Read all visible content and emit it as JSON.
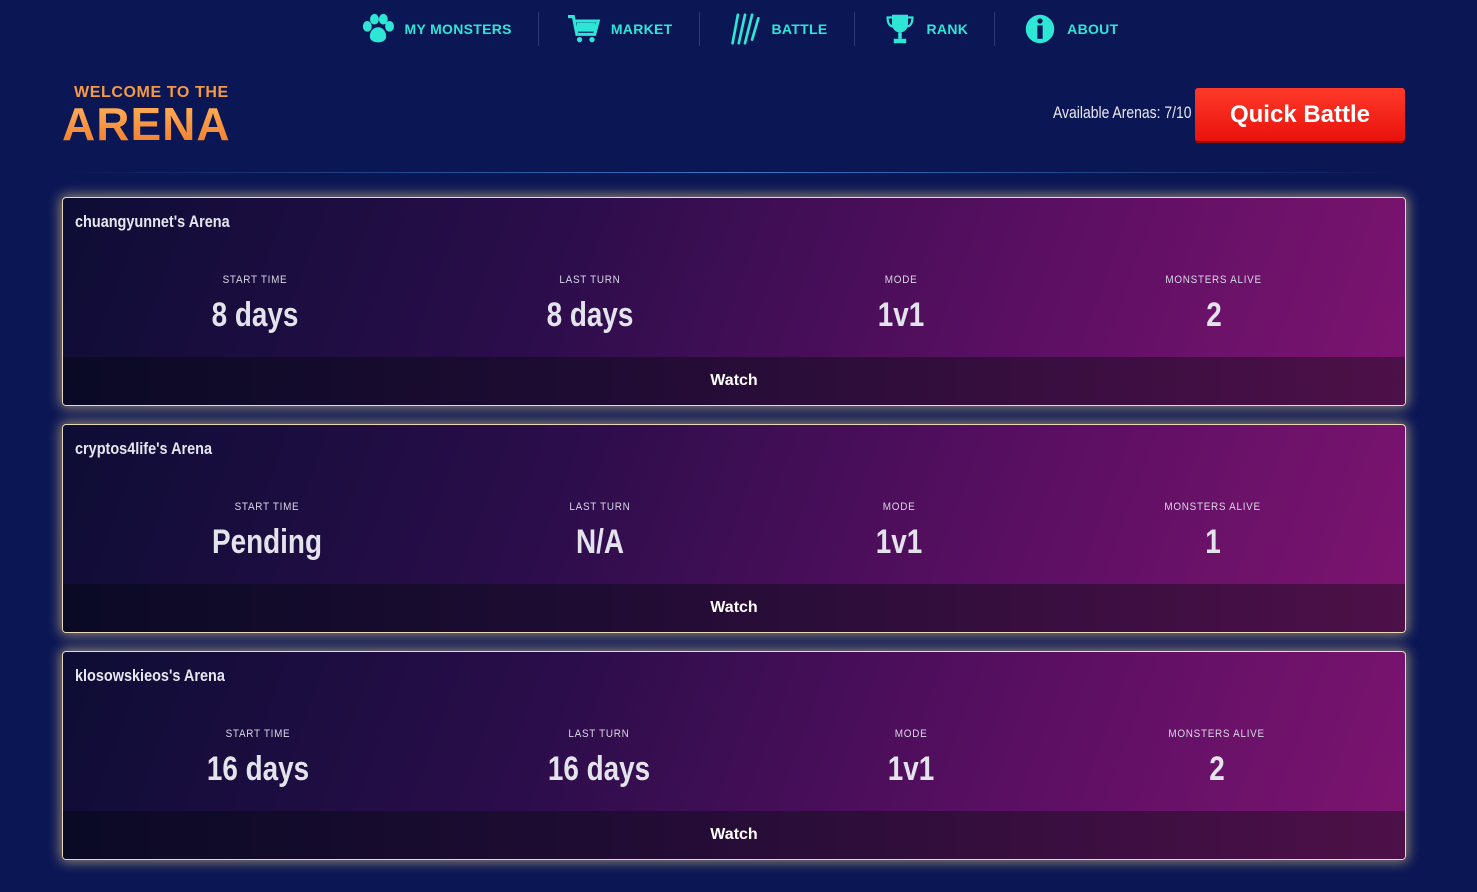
{
  "nav": {
    "items": [
      {
        "label": "MY MONSTERS",
        "icon": "paw-icon"
      },
      {
        "label": "MARKET",
        "icon": "cart-icon"
      },
      {
        "label": "BATTLE",
        "icon": "claw-icon"
      },
      {
        "label": "RANK",
        "icon": "trophy-icon"
      },
      {
        "label": "ABOUT",
        "icon": "info-icon"
      }
    ]
  },
  "header": {
    "welcome_small": "WELCOME TO THE",
    "welcome_big": "ARENA",
    "available_arenas": "Available Arenas: 7/10",
    "quick_battle_label": "Quick Battle"
  },
  "labels": {
    "start_time": "START TIME",
    "last_turn": "LAST TURN",
    "mode": "MODE",
    "monsters_alive": "MONSTERS ALIVE",
    "watch": "Watch"
  },
  "arenas": [
    {
      "title": "chuangyunnet's Arena",
      "start_time": "8 days",
      "last_turn": "8 days",
      "mode": "1v1",
      "monsters_alive": "2"
    },
    {
      "title": "cryptos4life's Arena",
      "start_time": "Pending",
      "last_turn": "N/A",
      "mode": "1v1",
      "monsters_alive": "1"
    },
    {
      "title": "klosowskieos's Arena",
      "start_time": "16 days",
      "last_turn": "16 days",
      "mode": "1v1",
      "monsters_alive": "2"
    }
  ],
  "colors": {
    "background": "#0b1655",
    "nav_accent": "#2ee6d6",
    "welcome_orange": "#f59a42",
    "quick_battle_red": "#ff2a1e",
    "card_border": "#e9d9b5"
  }
}
